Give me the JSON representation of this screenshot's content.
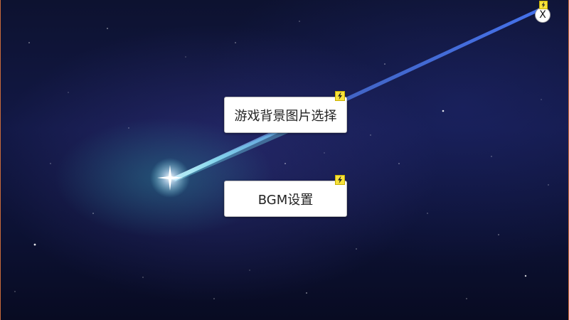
{
  "menu": {
    "background_select_label": "游戏背景图片选择",
    "bgm_settings_label": "BGM设置"
  },
  "window": {
    "close_label": "X"
  },
  "icons": {
    "badge": "lightning-bolt-icon",
    "badge_color": "#f7e23a"
  },
  "colors": {
    "sky_dark": "#0d1230",
    "meteor_trail": "#4a7bff",
    "button_bg": "#ffffff"
  }
}
